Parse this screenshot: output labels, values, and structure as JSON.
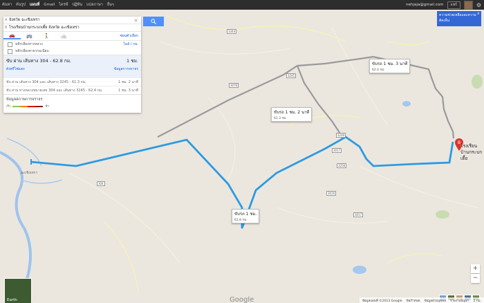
{
  "topbar": {
    "nav": [
      "ค้นหา",
      "ค้นรูป",
      "แผนที่",
      "Gmail",
      "ไดรฟ์",
      "ปฏิทิน",
      "แปลภาษา",
      "อื่นๆ"
    ],
    "email": "nehjaja@gmail.com",
    "share_label": "แชร์"
  },
  "directions": {
    "origin_label": "A",
    "origin_value": "จังหวัด ฉะเชิงเทรา",
    "dest_label": "B",
    "dest_value": "โรงเรียนบ้านกระบกเตี้ย จังหวัด ฉะเชิงเทรา",
    "options_link": "ซ่อนตัวเลือก",
    "avoid_highways": "หลีกเลี่ยงทางหลวง",
    "avoid_tolls": "หลีกเลี่ยงค่าธรรมเนียม",
    "unit_toggle": "ไมล์ / กม.",
    "main_route": {
      "desc": "ขับ ผ่าน เส้นทาง 304 - 62.8 กม.",
      "time": "1 ชม.",
      "link_left": "ดังตรีไฟแดง",
      "link_right": "ข้อมูลการจราจร"
    },
    "alt_routes": [
      {
        "desc": "ขับ ผ่าน เส้นทาง 304 และ เส้นทาง 3245 - 61.3 กม.",
        "time": "1 ชม. 2 นาที"
      },
      {
        "desc": "ขับ ผ่าน ทางหลวงหมายเลข 304 และ เส้นทาง 3245 - 62.4 กม.",
        "time": "1 ชม. 3 นาที"
      }
    ],
    "traffic_title": "ข้อมูลสภาพการจราจร",
    "traffic_fast": "เร็ว",
    "traffic_slow": "ช้า"
  },
  "callouts": [
    {
      "time": "ขับรถ 1 ชม. 3 นาที",
      "dist": "62.4 กม."
    },
    {
      "time": "ขับรถ 1 ชม. 2 นาที",
      "dist": "61.3 กม."
    },
    {
      "time": "ขับรถ 1 ชม.",
      "dist": "62.8 กม."
    }
  ],
  "destination_name": "โรงเรียนบ้านกระบกเตี้ย",
  "destination_marker": "B",
  "route_shields": [
    "3344",
    "3245",
    "3249",
    "3017",
    "3256",
    "3076",
    "3016",
    "3017",
    "304"
  ],
  "info_popup": "ความช่วยเหลือและความคิดเห็น",
  "earth_label": "Earth",
  "zoom_in": "+",
  "zoom_out": "−",
  "logo": "Google",
  "footer": [
    "ข้อมูลแผนที่ ©2013 Google",
    "ข้อกำหนด",
    "ข้อมูลส่วนบุคคล",
    "รายงานปัญหา",
    "2 กม."
  ],
  "colors": {
    "route_main": "#2d9ae0",
    "route_alt": "#999999",
    "accent": "#4d90fe",
    "marker": "#d9342b"
  }
}
